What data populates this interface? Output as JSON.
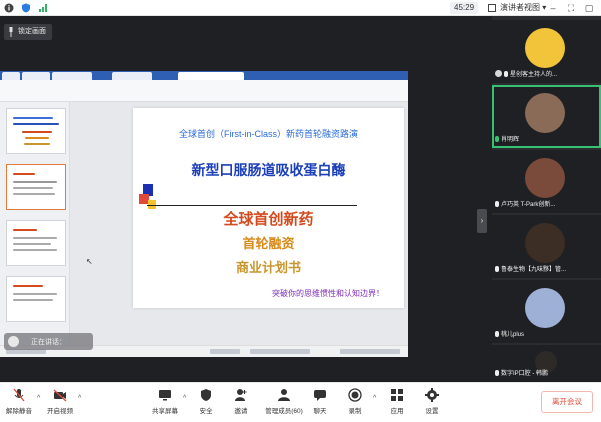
{
  "topbar": {
    "timer": "45:29",
    "view_mode": "演讲者视图",
    "view_caret": "▾",
    "icons": [
      "info-icon",
      "shield-icon",
      "signal-icon"
    ]
  },
  "stage": {
    "lock_label": "锁定画面",
    "sharer_label": "正在讲话：",
    "collapse_glyph": "›",
    "cursor_glyph": "↖"
  },
  "slide": {
    "top_line": "全球首创（First-in-Class）新药首轮融资路演",
    "main_title": "新型口服肠道吸收蛋白酶",
    "line1": "全球首创新药",
    "line2": "首轮融资",
    "line3": "商业计划书",
    "bottom_line": "突破你的思维惯性和认知边界！"
  },
  "participants": [
    {
      "name": "星创客主持人的...",
      "avatar_color": "#f2c43a",
      "mic": "off"
    },
    {
      "name": "肖明辉",
      "avatar_color": "#8a6b57",
      "mic": "on"
    },
    {
      "name": "卢巧英 T-Park创新...",
      "avatar_color": "#7a4a3a",
      "mic": "off"
    },
    {
      "name": "鲁泰生物【九味黟】管...",
      "avatar_color": "#3c2e24",
      "mic": "off"
    },
    {
      "name": "桃儿plus",
      "avatar_color": "#9fb0d6",
      "mic": "off"
    },
    {
      "name": "数字IP口腔 - 韩鹏",
      "avatar_color": "#2e2a28",
      "mic": "off"
    }
  ],
  "toolbar": {
    "items": [
      {
        "label": "解除静音",
        "icon": "mic-muted-icon"
      },
      {
        "label": "开启视频",
        "icon": "camera-off-icon"
      },
      {
        "label": "共享屏幕",
        "icon": "share-screen-icon"
      },
      {
        "label": "安全",
        "icon": "shield-icon"
      },
      {
        "label": "邀请",
        "icon": "invite-icon"
      },
      {
        "label": "管理成员(60)",
        "icon": "members-icon"
      },
      {
        "label": "聊天",
        "icon": "chat-icon"
      },
      {
        "label": "录制",
        "icon": "record-icon"
      },
      {
        "label": "应用",
        "icon": "apps-icon"
      },
      {
        "label": "设置",
        "icon": "settings-icon"
      }
    ],
    "leave_label": "离开会议"
  },
  "colors": {
    "stage_bg": "#1f2024",
    "panel_bg": "#2b2c30",
    "active_speaker": "#38c172",
    "leave_red": "#e04a3a"
  }
}
